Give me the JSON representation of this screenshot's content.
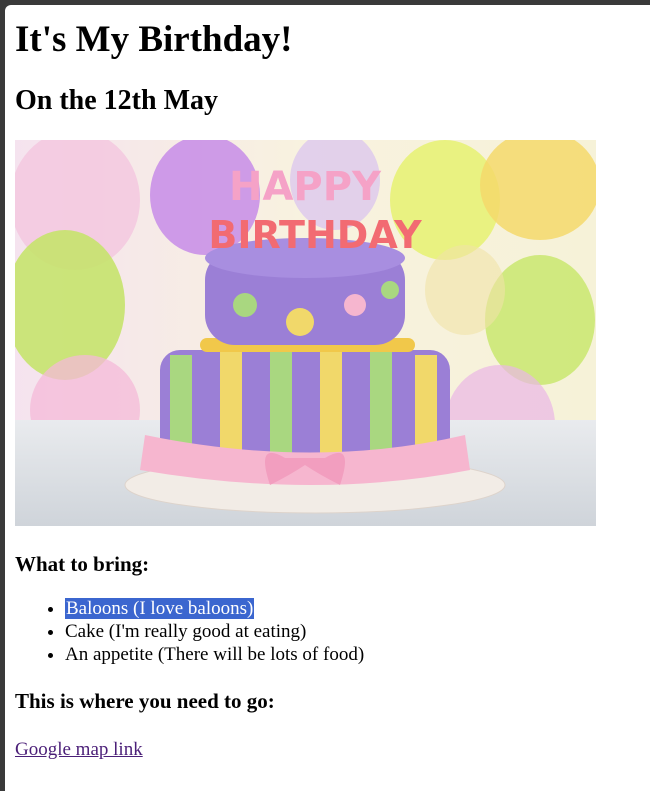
{
  "page": {
    "title": "It's My Birthday!",
    "date_heading": "On the 12th May",
    "bring_heading": "What to bring:",
    "bring_items": [
      "Baloons (I love baloons)",
      "Cake (I'm really good at eating)",
      "An appetite (There will be lots of food)"
    ],
    "where_heading": "This is where you need to go:",
    "map_link": "Google map link"
  },
  "image": {
    "cake_text_top": "HAPPY",
    "cake_text_bottom": "BIRTHDAY",
    "colors": {
      "cake_purple": "#9b7fd6",
      "ribbon_pink": "#f6b6cf",
      "stripe_yellow": "#f1d86a",
      "stripe_green": "#a9d780"
    }
  }
}
